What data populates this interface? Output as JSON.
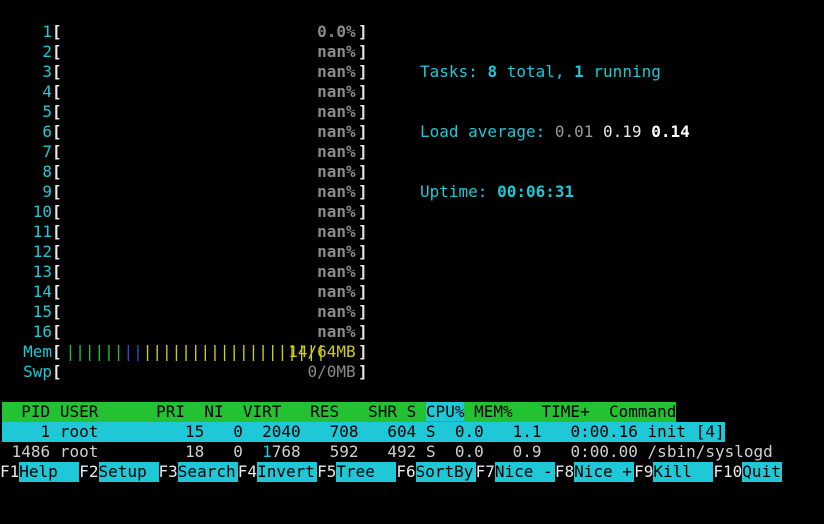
{
  "cpus": [
    {
      "num": "1",
      "value": "0.0%"
    },
    {
      "num": "2",
      "value": "nan%"
    },
    {
      "num": "3",
      "value": "nan%"
    },
    {
      "num": "4",
      "value": "nan%"
    },
    {
      "num": "5",
      "value": "nan%"
    },
    {
      "num": "6",
      "value": "nan%"
    },
    {
      "num": "7",
      "value": "nan%"
    },
    {
      "num": "8",
      "value": "nan%"
    },
    {
      "num": "9",
      "value": "nan%"
    },
    {
      "num": "10",
      "value": "nan%"
    },
    {
      "num": "11",
      "value": "nan%"
    },
    {
      "num": "12",
      "value": "nan%"
    },
    {
      "num": "13",
      "value": "nan%"
    },
    {
      "num": "14",
      "value": "nan%"
    },
    {
      "num": "15",
      "value": "nan%"
    },
    {
      "num": "16",
      "value": "nan%"
    }
  ],
  "mem": {
    "label": "Mem",
    "value": "14/64MB",
    "bars_green": "||||||",
    "bars_blue": "||",
    "bars_yellow": "|||||||||||||||||||"
  },
  "swp": {
    "label": "Swp",
    "value": "0/0MB"
  },
  "summary": {
    "tasks_label": "Tasks: ",
    "tasks_total": "8",
    "tasks_total_suffix": " total, ",
    "tasks_running": "1",
    "tasks_running_suffix": " running",
    "load_label": "Load average: ",
    "load_1": "0.01",
    "load_5": "0.19",
    "load_15": "0.14",
    "uptime_label": "Uptime: ",
    "uptime_value": "00:06:31"
  },
  "columns": {
    "pid": "PID",
    "user": "USER",
    "pri": "PRI",
    "ni": "NI",
    "virt": "VIRT",
    "res": "RES",
    "shr": "SHR",
    "s": "S",
    "cpu": "CPU%",
    "mem": "MEM%",
    "time": "TIME+",
    "command": "Command"
  },
  "processes": [
    {
      "pid": "1",
      "user": "root",
      "pri": "15",
      "ni": "0",
      "virt": "2040",
      "res": "708",
      "shr": "604",
      "s": "S",
      "cpu": "0.0",
      "mem": "1.1",
      "time": "0:00.16",
      "command": "init [4]"
    },
    {
      "pid": "1486",
      "user": "root",
      "pri": "18",
      "ni": "0",
      "virt_hl": "1",
      "virt_rest": "768",
      "res": "592",
      "shr": "492",
      "s": "S",
      "cpu": "0.0",
      "mem": "0.9",
      "time": "0:00.00",
      "command": "/sbin/syslogd"
    }
  ],
  "fkeys": [
    {
      "key": "F1",
      "label": "Help"
    },
    {
      "key": "F2",
      "label": "Setup"
    },
    {
      "key": "F3",
      "label": "Search"
    },
    {
      "key": "F4",
      "label": "Invert"
    },
    {
      "key": "F5",
      "label": "Tree"
    },
    {
      "key": "F6",
      "label": "SortBy"
    },
    {
      "key": "F7",
      "label": "Nice -"
    },
    {
      "key": "F8",
      "label": "Nice +"
    },
    {
      "key": "F9",
      "label": "Kill"
    },
    {
      "key": "F10",
      "label": "Quit"
    }
  ],
  "colors": {
    "background": "#000000",
    "cyan": "#1ec8d6",
    "header_green": "#22c232",
    "bar_blue": "#2a4dd4",
    "bar_yellow": "#cccc22"
  }
}
